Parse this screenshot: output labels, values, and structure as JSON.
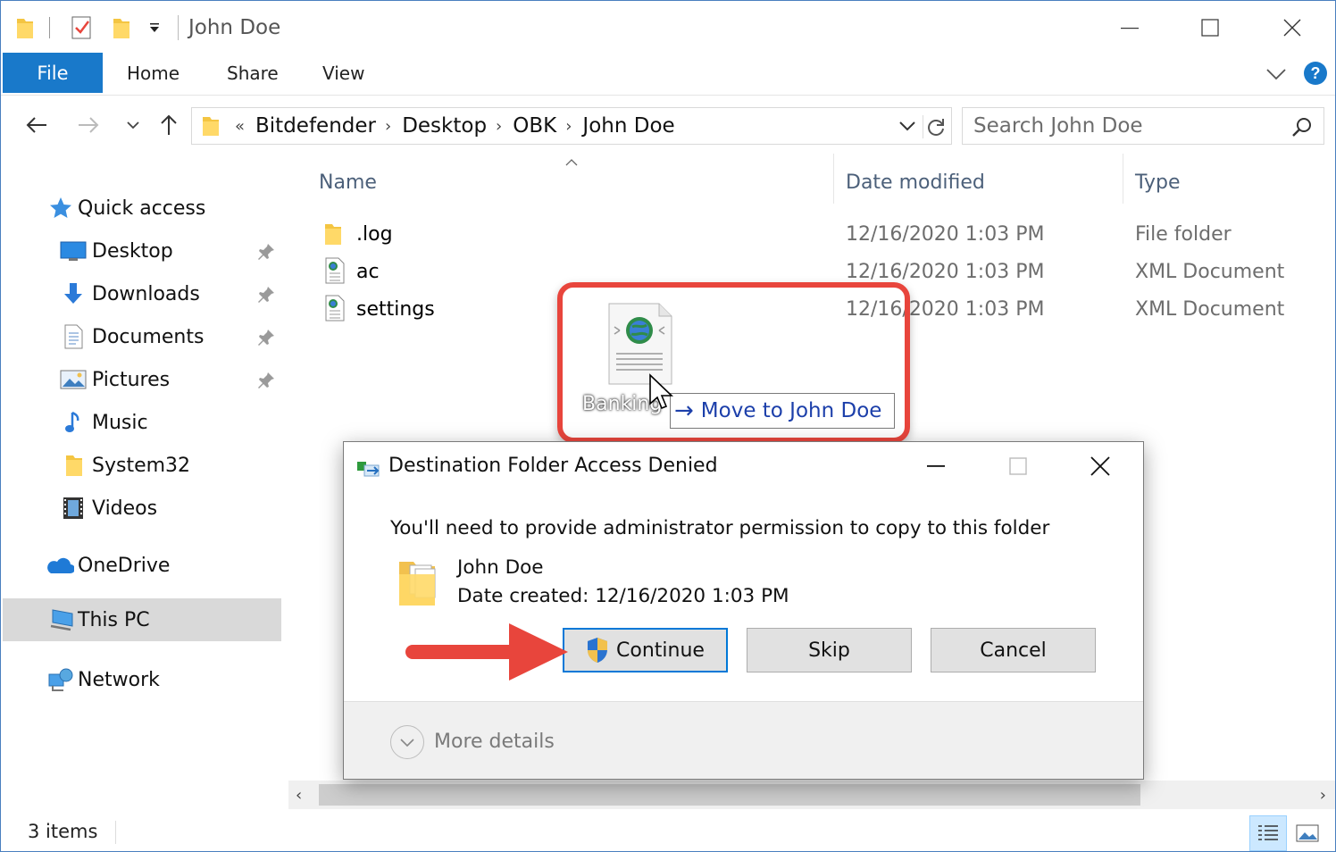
{
  "window": {
    "title": "John Doe",
    "controls": {
      "minimize": "minimize-icon",
      "maximize": "maximize-icon",
      "close": "close-icon"
    }
  },
  "ribbon": {
    "tabs": [
      "File",
      "Home",
      "Share",
      "View"
    ],
    "active_tab": "File",
    "accent": "#1979ca"
  },
  "address": {
    "overflow": "«",
    "crumbs": [
      "Bitdefender",
      "Desktop",
      "OBK",
      "John Doe"
    ],
    "search_placeholder": "Search John Doe"
  },
  "sidebar": {
    "quick_access": "Quick access",
    "pinned": [
      {
        "label": "Desktop",
        "icon": "desktop-icon"
      },
      {
        "label": "Downloads",
        "icon": "downloads-icon"
      },
      {
        "label": "Documents",
        "icon": "documents-icon"
      },
      {
        "label": "Pictures",
        "icon": "pictures-icon"
      }
    ],
    "other": [
      {
        "label": "Music",
        "icon": "music-icon"
      },
      {
        "label": "System32",
        "icon": "folder-icon"
      },
      {
        "label": "Videos",
        "icon": "videos-icon"
      }
    ],
    "onedrive": "OneDrive",
    "this_pc": "This PC",
    "network": "Network"
  },
  "columns": {
    "name": "Name",
    "date": "Date modified",
    "type": "Type"
  },
  "files": [
    {
      "name": ".log",
      "date": "12/16/2020 1:03 PM",
      "type": "File folder",
      "icon": "folder-icon"
    },
    {
      "name": "ac",
      "date": "12/16/2020 1:03 PM",
      "type": "XML Document",
      "icon": "xml-document-icon"
    },
    {
      "name": "settings",
      "date": "12/16/2020 1:03 PM",
      "type": "XML Document",
      "icon": "xml-document-icon"
    }
  ],
  "drag": {
    "file_label": "Banking",
    "tooltip": "Move to John Doe"
  },
  "dialog": {
    "title": "Destination Folder Access Denied",
    "message": "You'll need to provide administrator permission to copy to this folder",
    "folder_name": "John Doe",
    "folder_date": "Date created: 12/16/2020 1:03 PM",
    "buttons": {
      "continue": "Continue",
      "skip": "Skip",
      "cancel": "Cancel"
    },
    "more_details": "More details"
  },
  "status": {
    "items": "3 items"
  },
  "annotation_color": "#e8453c"
}
